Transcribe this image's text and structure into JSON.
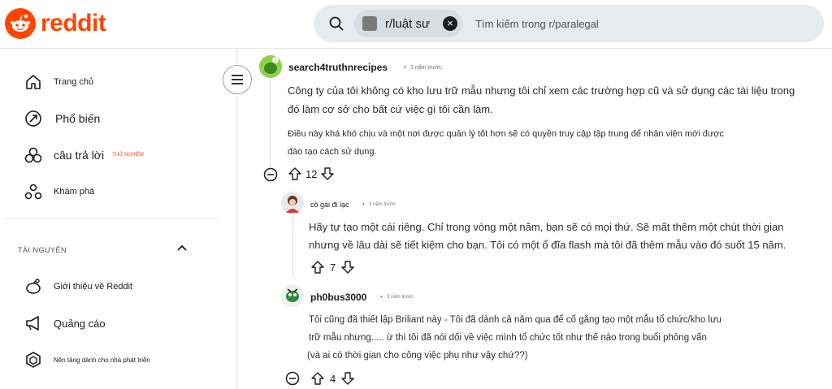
{
  "brand": {
    "logo_text": "reddit",
    "accent": "#ff4500"
  },
  "search": {
    "community_chip": "r/luật sư",
    "placeholder": "Tìm kiếm trong r/paralegal"
  },
  "sidebar": {
    "items": [
      {
        "label": "Trang chủ",
        "icon": "home-icon"
      },
      {
        "label": "Phổ biến",
        "icon": "popular-icon"
      },
      {
        "label": "câu trả lời",
        "icon": "answers-icon",
        "badge": "THỬ NGHIỆM"
      },
      {
        "label": "Khám phá",
        "icon": "explore-icon"
      }
    ],
    "resources_title": "TÀI NGUYÊN",
    "resources": [
      {
        "label": "Giới thiệu về Reddit",
        "icon": "about-reddit-icon"
      },
      {
        "label": "Quảng cáo",
        "icon": "advertise-icon"
      },
      {
        "label": "Nền tảng dành cho nhà phát triển",
        "icon": "developer-icon"
      }
    ]
  },
  "comments": [
    {
      "author": "search4truthnrecipes",
      "time": "3 năm trước",
      "paragraphs": [
        "Công ty của tôi không có kho lưu trữ mẫu nhưng tôi chỉ xem các trường hợp cũ và sử dụng các tài liệu trong",
        "đó làm cơ sở cho bất cứ việc gì tôi cần làm.",
        "Điều này khá khó chịu và một nơi được quản lý tốt hơn sẽ có quyền truy cập tập trung để nhân viên mới được",
        "đào tạo cách sử dụng."
      ],
      "score": "12"
    },
    {
      "author": "cô gái đi lạc",
      "time": "3 năm trước",
      "paragraphs": [
        "Hãy tự tạo một cái riêng. Chỉ trong vòng một năm, bạn sẽ có mọi thứ. Sẽ mất thêm một chút thời gian",
        "nhưng về lâu dài sẽ tiết kiệm cho bạn. Tôi có một ổ đĩa flash mà tôi đã thêm mẫu vào đó suốt 15 năm."
      ],
      "score": "7"
    },
    {
      "author": "ph0bus3000",
      "time": "3 năm trước",
      "paragraphs": [
        "Tôi cũng đã thiết lập Briliant này - Tôi đã dành cả năm qua để cố gắng tạo một mẫu tổ chức/kho lưu",
        "trữ mẫu nhưng..... ừ thì tôi đã nói dối về việc mình tổ chức tốt như thế nào trong buổi phỏng vấn",
        "(và ai có thời gian cho công việc phụ như vậy chứ??)"
      ],
      "score": "4"
    }
  ]
}
